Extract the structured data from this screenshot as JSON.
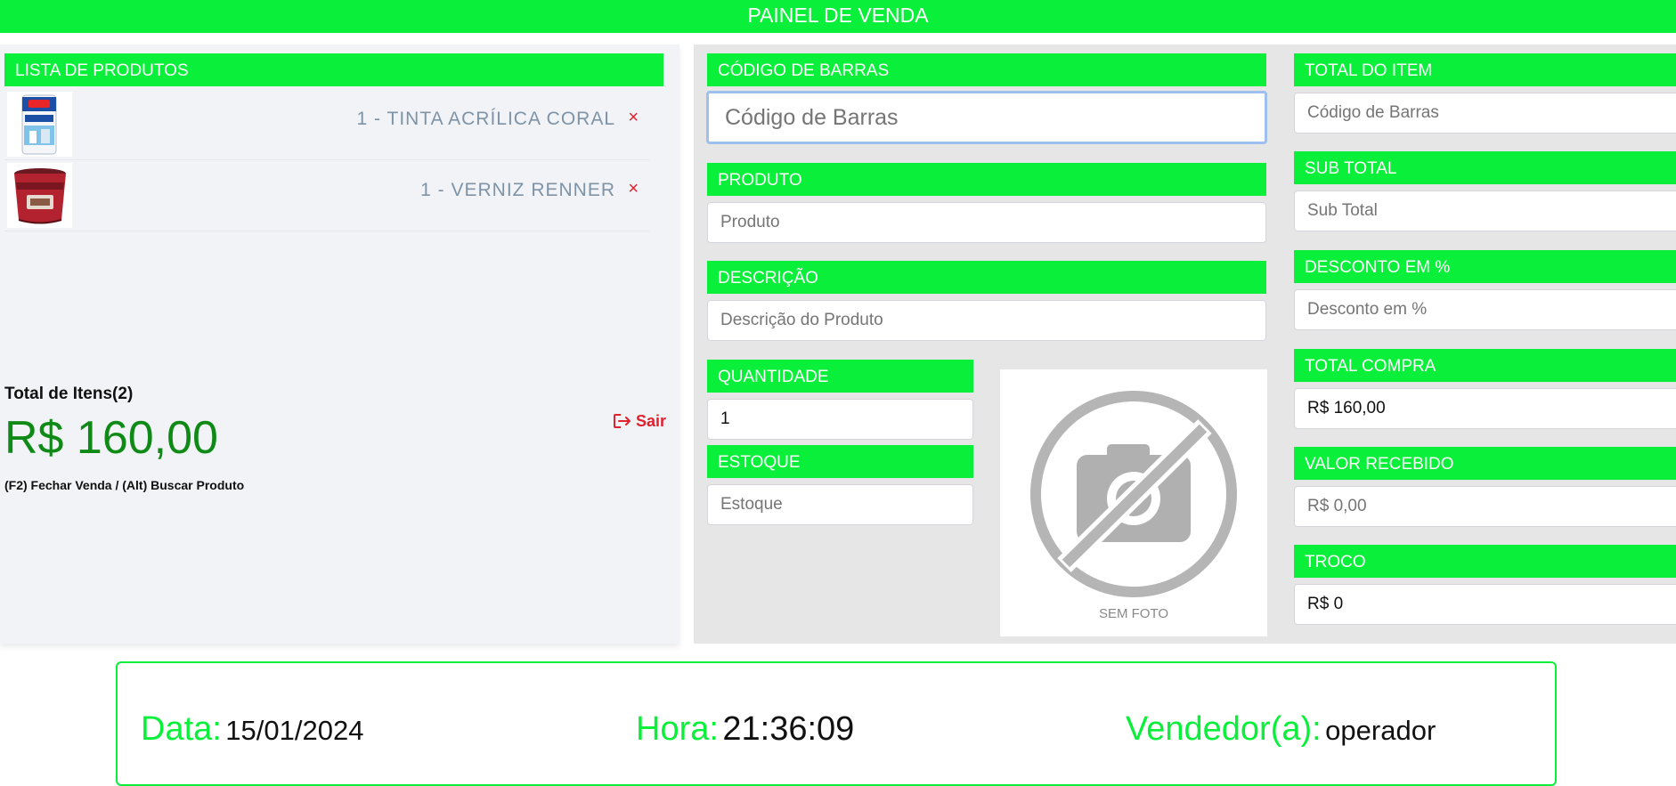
{
  "header": {
    "title": "PAINEL DE VENDA"
  },
  "product_list": {
    "title": "LISTA DE PRODUTOS",
    "items": [
      {
        "label": "1 - TINTA ACRÍLICA CORAL",
        "remove": "×",
        "image": "coral-paint-can-icon"
      },
      {
        "label": "1 - VERNIZ RENNER",
        "remove": "×",
        "image": "renner-varnish-bucket-icon"
      }
    ],
    "total_items_label": "Total de Itens(2)",
    "total_value": "R$ 160,00",
    "shortcuts": "(F2) Fechar Venda / (Alt) Buscar Produto",
    "exit_label": "Sair",
    "exit_icon": "sign-out-icon"
  },
  "form": {
    "barcode": {
      "label": "CÓDIGO DE BARRAS",
      "placeholder": "Código de Barras",
      "value": ""
    },
    "product": {
      "label": "PRODUTO",
      "placeholder": "Produto",
      "value": ""
    },
    "description": {
      "label": "DESCRIÇÃO",
      "placeholder": "Descrição do Produto",
      "value": ""
    },
    "quantity": {
      "label": "QUANTIDADE",
      "value": "1"
    },
    "stock": {
      "label": "ESTOQUE",
      "placeholder": "Estoque",
      "value": ""
    },
    "photo": {
      "caption": "SEM FOTO",
      "icon": "no-camera-icon"
    }
  },
  "totals": {
    "item_total": {
      "label": "TOTAL DO ITEM",
      "placeholder": "Código de Barras",
      "value": ""
    },
    "sub_total": {
      "label": "SUB TOTAL",
      "placeholder": "Sub Total",
      "value": ""
    },
    "discount": {
      "label": "DESCONTO EM %",
      "placeholder": "Desconto em %",
      "value": ""
    },
    "purchase_total": {
      "label": "TOTAL COMPRA",
      "value": "R$ 160,00"
    },
    "received": {
      "label": "VALOR RECEBIDO",
      "placeholder": "R$ 0,00",
      "value": ""
    },
    "change": {
      "label": "TROCO",
      "value": "R$ 0"
    }
  },
  "footer": {
    "date_label": "Data:",
    "date_value": "15/01/2024",
    "time_label": "Hora:",
    "time_value": "21:36:09",
    "seller_label": "Vendedor(a):",
    "seller_value": "operador"
  },
  "colors": {
    "accent": "#0aef3a",
    "total_green": "#0f8a16",
    "danger": "#e0212f",
    "panel_bg": "#e6e6e6",
    "list_bg": "#f1f3f7"
  }
}
